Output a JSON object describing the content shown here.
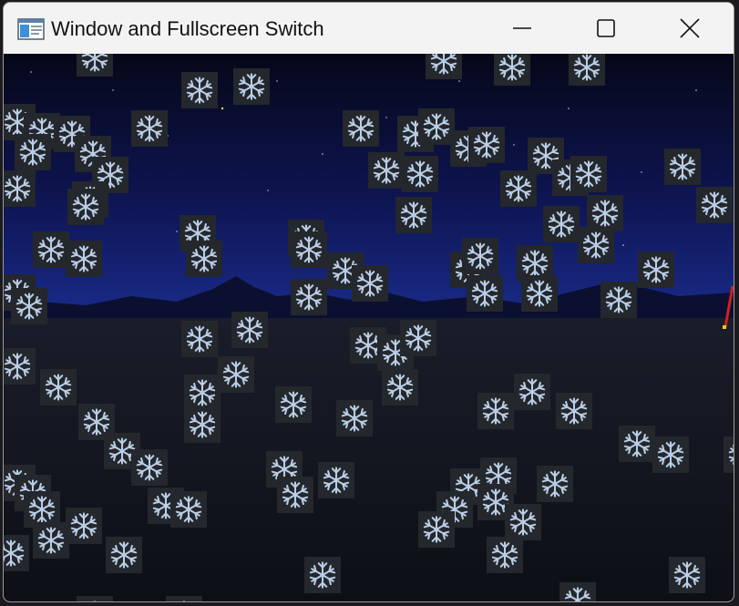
{
  "window": {
    "title": "Window and Fullscreen Switch"
  },
  "controls": {
    "minimize_icon": "minimize-icon",
    "maximize_icon": "maximize-icon",
    "close_icon": "close-icon"
  },
  "scene": {
    "sky_top_color": "#060818",
    "sky_horizon_color": "#1a2b8a",
    "ground_color": "#14161f",
    "flake_color": "#b9cde6",
    "flake_tile_color": "#24272c",
    "flake_icon": "snowflake-icon"
  }
}
